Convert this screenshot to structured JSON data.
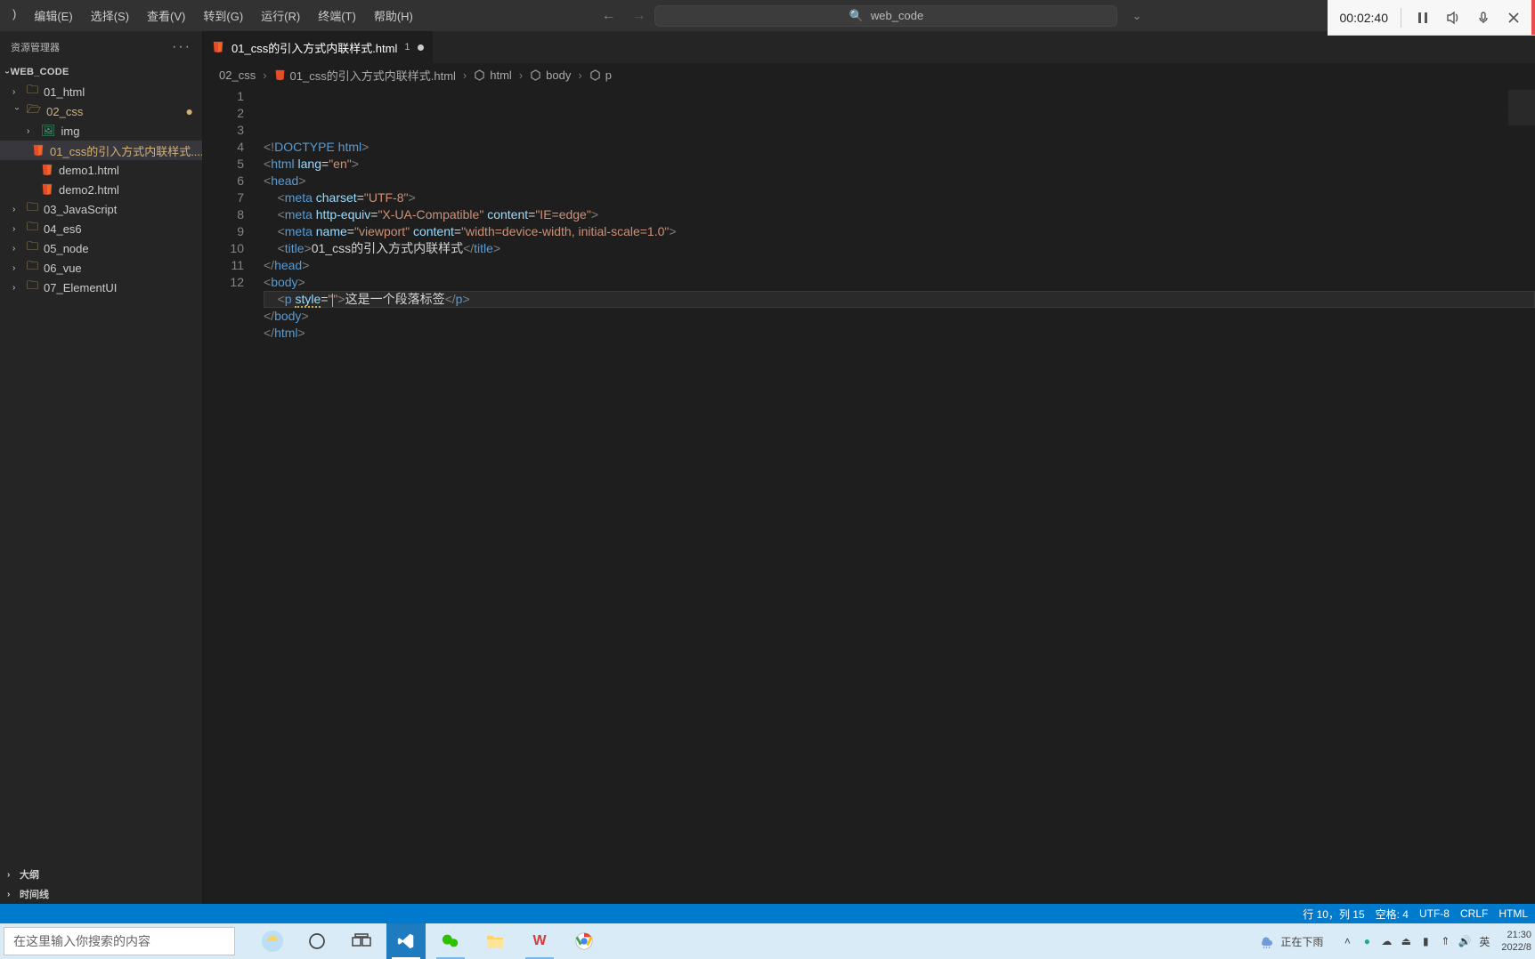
{
  "menu": {
    "items": [
      ")",
      "编辑(E)",
      "选择(S)",
      "查看(V)",
      "转到(G)",
      "运行(R)",
      "终端(T)",
      "帮助(H)"
    ]
  },
  "command_center": {
    "text": "web_code"
  },
  "recorder": {
    "timer": "00:02:40"
  },
  "sidebar": {
    "header": "资源管理器",
    "section_title": "WEB_CODE",
    "tree": [
      {
        "label": "01_html",
        "type": "folder",
        "depth": 1
      },
      {
        "label": "02_css",
        "type": "folder-open",
        "depth": 1,
        "modified": true
      },
      {
        "label": "img",
        "type": "folder-img",
        "depth": 2
      },
      {
        "label": "01_css的引入方式内联样式....",
        "type": "html",
        "depth": 2,
        "active": true,
        "modified": true,
        "badge": "1"
      },
      {
        "label": "demo1.html",
        "type": "html",
        "depth": 2
      },
      {
        "label": "demo2.html",
        "type": "html",
        "depth": 2
      },
      {
        "label": "03_JavaScript",
        "type": "folder",
        "depth": 1
      },
      {
        "label": "04_es6",
        "type": "folder",
        "depth": 1
      },
      {
        "label": "05_node",
        "type": "folder",
        "depth": 1
      },
      {
        "label": "06_vue",
        "type": "folder",
        "depth": 1
      },
      {
        "label": "07_ElementUI",
        "type": "folder",
        "depth": 1
      }
    ],
    "footer": [
      "大纲",
      "时间线"
    ]
  },
  "tab": {
    "label": "01_css的引入方式内联样式.html",
    "badge": "1"
  },
  "breadcrumbs": {
    "items": [
      "02_css",
      "01_css的引入方式内联样式.html",
      "html",
      "body",
      "p"
    ]
  },
  "code": {
    "lines": [
      {
        "n": "1",
        "parts": [
          {
            "t": "<!",
            "c": "p-br"
          },
          {
            "t": "DOCTYPE",
            "c": "p-doctype"
          },
          {
            "t": " ",
            "c": "p-text"
          },
          {
            "t": "html",
            "c": "p-tag"
          },
          {
            "t": ">",
            "c": "p-br"
          }
        ]
      },
      {
        "n": "2",
        "parts": [
          {
            "t": "<",
            "c": "p-br"
          },
          {
            "t": "html",
            "c": "p-tag"
          },
          {
            "t": " ",
            "c": "p-text"
          },
          {
            "t": "lang",
            "c": "p-attr"
          },
          {
            "t": "=",
            "c": "p-text"
          },
          {
            "t": "\"en\"",
            "c": "p-str"
          },
          {
            "t": ">",
            "c": "p-br"
          }
        ]
      },
      {
        "n": "3",
        "parts": [
          {
            "t": "<",
            "c": "p-br"
          },
          {
            "t": "head",
            "c": "p-tag"
          },
          {
            "t": ">",
            "c": "p-br"
          }
        ]
      },
      {
        "n": "4",
        "indent": 4,
        "parts": [
          {
            "t": "<",
            "c": "p-br"
          },
          {
            "t": "meta",
            "c": "p-tag"
          },
          {
            "t": " ",
            "c": "p-text"
          },
          {
            "t": "charset",
            "c": "p-attr"
          },
          {
            "t": "=",
            "c": "p-text"
          },
          {
            "t": "\"UTF-8\"",
            "c": "p-str"
          },
          {
            "t": ">",
            "c": "p-br"
          }
        ]
      },
      {
        "n": "5",
        "indent": 4,
        "parts": [
          {
            "t": "<",
            "c": "p-br"
          },
          {
            "t": "meta",
            "c": "p-tag"
          },
          {
            "t": " ",
            "c": "p-text"
          },
          {
            "t": "http-equiv",
            "c": "p-attr"
          },
          {
            "t": "=",
            "c": "p-text"
          },
          {
            "t": "\"X-UA-Compatible\"",
            "c": "p-str"
          },
          {
            "t": " ",
            "c": "p-text"
          },
          {
            "t": "content",
            "c": "p-attr"
          },
          {
            "t": "=",
            "c": "p-text"
          },
          {
            "t": "\"IE=edge\"",
            "c": "p-str"
          },
          {
            "t": ">",
            "c": "p-br"
          }
        ]
      },
      {
        "n": "6",
        "indent": 4,
        "parts": [
          {
            "t": "<",
            "c": "p-br"
          },
          {
            "t": "meta",
            "c": "p-tag"
          },
          {
            "t": " ",
            "c": "p-text"
          },
          {
            "t": "name",
            "c": "p-attr"
          },
          {
            "t": "=",
            "c": "p-text"
          },
          {
            "t": "\"viewport\"",
            "c": "p-str"
          },
          {
            "t": " ",
            "c": "p-text"
          },
          {
            "t": "content",
            "c": "p-attr"
          },
          {
            "t": "=",
            "c": "p-text"
          },
          {
            "t": "\"width=device-width, initial-scale=1.0\"",
            "c": "p-str"
          },
          {
            "t": ">",
            "c": "p-br"
          }
        ]
      },
      {
        "n": "7",
        "indent": 4,
        "parts": [
          {
            "t": "<",
            "c": "p-br"
          },
          {
            "t": "title",
            "c": "p-tag"
          },
          {
            "t": ">",
            "c": "p-br"
          },
          {
            "t": "01_css的引入方式内联样式",
            "c": "p-text"
          },
          {
            "t": "</",
            "c": "p-br"
          },
          {
            "t": "title",
            "c": "p-tag"
          },
          {
            "t": ">",
            "c": "p-br"
          }
        ]
      },
      {
        "n": "8",
        "parts": [
          {
            "t": "</",
            "c": "p-br"
          },
          {
            "t": "head",
            "c": "p-tag"
          },
          {
            "t": ">",
            "c": "p-br"
          }
        ]
      },
      {
        "n": "9",
        "parts": [
          {
            "t": "<",
            "c": "p-br"
          },
          {
            "t": "body",
            "c": "p-tag"
          },
          {
            "t": ">",
            "c": "p-br"
          }
        ]
      },
      {
        "n": "10",
        "hl": true,
        "indent": 4,
        "parts": [
          {
            "t": "<",
            "c": "p-br"
          },
          {
            "t": "p",
            "c": "p-tag"
          },
          {
            "t": " ",
            "c": "p-text"
          },
          {
            "t": "style",
            "c": "p-attr",
            "sq": true
          },
          {
            "t": "=",
            "c": "p-text"
          },
          {
            "t": "\"",
            "c": "p-str"
          },
          {
            "caret": true
          },
          {
            "t": "\"",
            "c": "p-str"
          },
          {
            "t": ">",
            "c": "p-br"
          },
          {
            "t": "这是一个段落标签",
            "c": "p-text"
          },
          {
            "t": "</",
            "c": "p-br"
          },
          {
            "t": "p",
            "c": "p-tag"
          },
          {
            "t": ">",
            "c": "p-br"
          }
        ]
      },
      {
        "n": "11",
        "parts": [
          {
            "t": "</",
            "c": "p-br"
          },
          {
            "t": "body",
            "c": "p-tag"
          },
          {
            "t": ">",
            "c": "p-br"
          }
        ]
      },
      {
        "n": "12",
        "parts": [
          {
            "t": "</",
            "c": "p-br"
          },
          {
            "t": "html",
            "c": "p-tag"
          },
          {
            "t": ">",
            "c": "p-br"
          }
        ]
      }
    ]
  },
  "statusbar": {
    "items": [
      "行 10，列 15",
      "空格: 4",
      "UTF-8",
      "CRLF",
      "HTML"
    ]
  },
  "taskbar": {
    "search_placeholder": "在这里输入你搜索的内容",
    "weather": "正在下雨",
    "ime": "英",
    "time": "21:30",
    "date": "2022/8"
  }
}
